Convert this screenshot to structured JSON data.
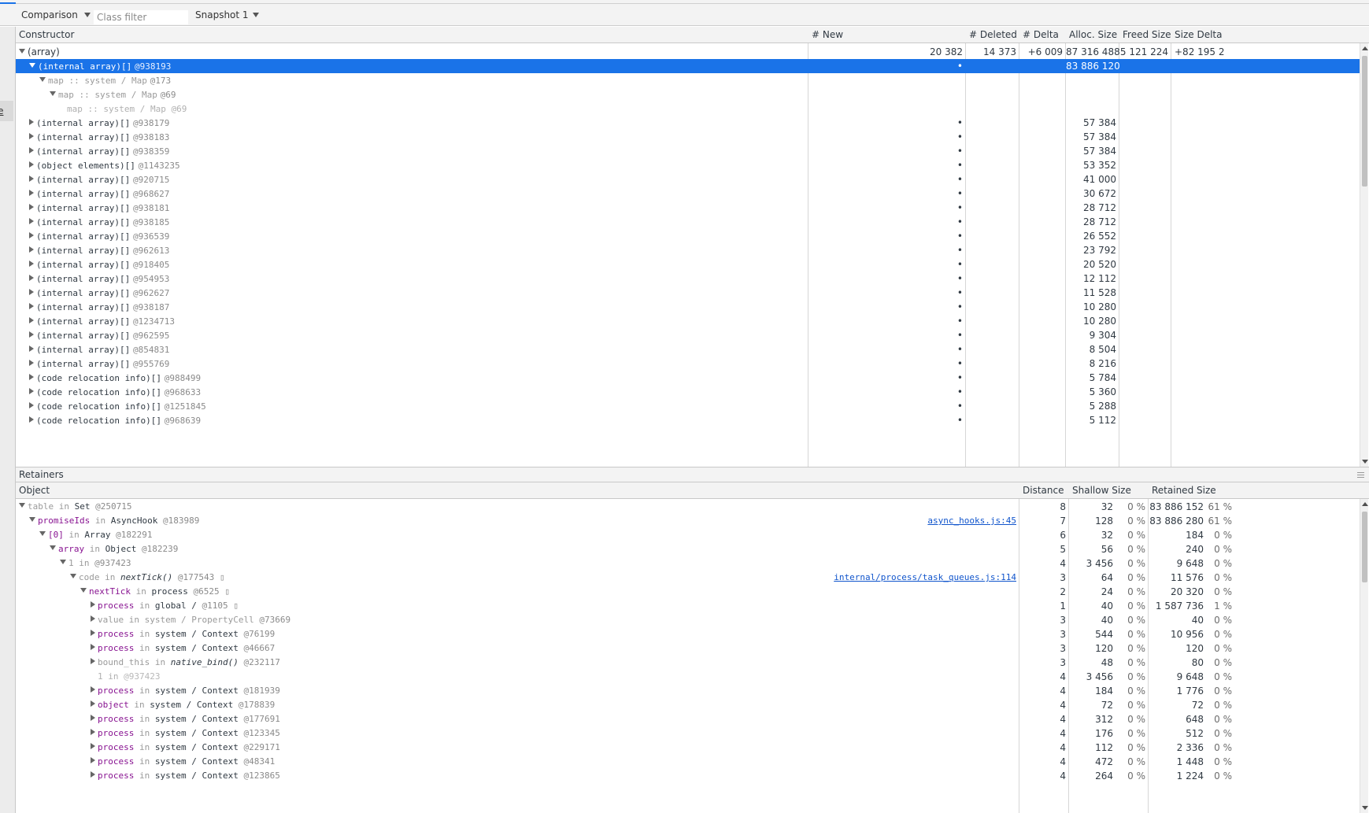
{
  "toolbar": {
    "view_mode": "Comparison",
    "class_filter_placeholder": "Class filter",
    "snapshot": "Snapshot 1"
  },
  "gutter_tab_label": "ve",
  "constructors": {
    "columns": [
      "Constructor",
      "# New",
      "# Deleted",
      "# Delta",
      "Alloc. Size",
      "Freed Size",
      "Size Delta"
    ],
    "rows": [
      {
        "level": 0,
        "state": "expanded",
        "name": "(array)",
        "id": "",
        "plain": true,
        "new": "20 382",
        "deleted": "14 373",
        "delta": "+6 009",
        "alloc": "87 316 488",
        "freed": "5 121 224",
        "sizeDelta": "+82 195 2…"
      },
      {
        "level": 1,
        "state": "expanded",
        "name": "(internal array)[]",
        "id": "@938193",
        "new": "•",
        "deleted": "",
        "delta": "",
        "alloc": "83 886 120",
        "freed": "",
        "sizeDelta": "",
        "selected": true
      },
      {
        "level": 2,
        "state": "expanded",
        "name": "map :: system / Map",
        "id": "@173",
        "greyName": true,
        "new": "",
        "deleted": "",
        "delta": "",
        "alloc": "",
        "freed": "",
        "sizeDelta": ""
      },
      {
        "level": 3,
        "state": "expanded",
        "name": "map :: system / Map",
        "id": "@69",
        "greyName": true,
        "new": "",
        "deleted": "",
        "delta": "",
        "alloc": "",
        "freed": "",
        "sizeDelta": ""
      },
      {
        "level": 4,
        "state": "none",
        "name": "map :: system / Map @69",
        "id": "",
        "faded": true,
        "new": "",
        "deleted": "",
        "delta": "",
        "alloc": "",
        "freed": "",
        "sizeDelta": ""
      },
      {
        "level": 1,
        "state": "collapsed",
        "name": "(internal array)[]",
        "id": "@938179",
        "new": "•",
        "alloc": "57 384"
      },
      {
        "level": 1,
        "state": "collapsed",
        "name": "(internal array)[]",
        "id": "@938183",
        "new": "•",
        "alloc": "57 384"
      },
      {
        "level": 1,
        "state": "collapsed",
        "name": "(internal array)[]",
        "id": "@938359",
        "new": "•",
        "alloc": "57 384"
      },
      {
        "level": 1,
        "state": "collapsed",
        "name": "(object elements)[]",
        "id": "@1143235",
        "new": "•",
        "alloc": "53 352"
      },
      {
        "level": 1,
        "state": "collapsed",
        "name": "(internal array)[]",
        "id": "@920715",
        "new": "•",
        "alloc": "41 000"
      },
      {
        "level": 1,
        "state": "collapsed",
        "name": "(internal array)[]",
        "id": "@968627",
        "new": "•",
        "alloc": "30 672"
      },
      {
        "level": 1,
        "state": "collapsed",
        "name": "(internal array)[]",
        "id": "@938181",
        "new": "•",
        "alloc": "28 712"
      },
      {
        "level": 1,
        "state": "collapsed",
        "name": "(internal array)[]",
        "id": "@938185",
        "new": "•",
        "alloc": "28 712"
      },
      {
        "level": 1,
        "state": "collapsed",
        "name": "(internal array)[]",
        "id": "@936539",
        "new": "•",
        "alloc": "26 552"
      },
      {
        "level": 1,
        "state": "collapsed",
        "name": "(internal array)[]",
        "id": "@962613",
        "new": "•",
        "alloc": "23 792"
      },
      {
        "level": 1,
        "state": "collapsed",
        "name": "(internal array)[]",
        "id": "@918405",
        "new": "•",
        "alloc": "20 520"
      },
      {
        "level": 1,
        "state": "collapsed",
        "name": "(internal array)[]",
        "id": "@954953",
        "new": "•",
        "alloc": "12 112"
      },
      {
        "level": 1,
        "state": "collapsed",
        "name": "(internal array)[]",
        "id": "@962627",
        "new": "•",
        "alloc": "11 528"
      },
      {
        "level": 1,
        "state": "collapsed",
        "name": "(internal array)[]",
        "id": "@938187",
        "new": "•",
        "alloc": "10 280"
      },
      {
        "level": 1,
        "state": "collapsed",
        "name": "(internal array)[]",
        "id": "@1234713",
        "new": "•",
        "alloc": "10 280"
      },
      {
        "level": 1,
        "state": "collapsed",
        "name": "(internal array)[]",
        "id": "@962595",
        "new": "•",
        "alloc": "9 304"
      },
      {
        "level": 1,
        "state": "collapsed",
        "name": "(internal array)[]",
        "id": "@854831",
        "new": "•",
        "alloc": "8 504"
      },
      {
        "level": 1,
        "state": "collapsed",
        "name": "(internal array)[]",
        "id": "@955769",
        "new": "•",
        "alloc": "8 216"
      },
      {
        "level": 1,
        "state": "collapsed",
        "name": "(code relocation info)[]",
        "id": "@988499",
        "new": "•",
        "alloc": "5 784"
      },
      {
        "level": 1,
        "state": "collapsed",
        "name": "(code relocation info)[]",
        "id": "@968633",
        "new": "•",
        "alloc": "5 360"
      },
      {
        "level": 1,
        "state": "collapsed",
        "name": "(code relocation info)[]",
        "id": "@1251845",
        "new": "•",
        "alloc": "5 288"
      },
      {
        "level": 1,
        "state": "collapsed",
        "name": "(code relocation info)[]",
        "id": "@968639",
        "new": "•",
        "alloc": "5 112"
      }
    ]
  },
  "retainers": {
    "title": "Retainers",
    "columns": [
      "Object",
      "Distance",
      "Shallow Size",
      "Retained Size"
    ],
    "rows": [
      {
        "level": 0,
        "state": "expanded",
        "prop": "table",
        "propGrey": true,
        "in": "in",
        "cls": "Set",
        "id": "@250715",
        "link": "",
        "distance": "8",
        "shallow": "32",
        "shallowPct": "0 %",
        "retained": "83 886 152",
        "retainedPct": "61 %"
      },
      {
        "level": 1,
        "state": "expanded",
        "prop": "promiseIds",
        "in": "in",
        "cls": "AsyncHook",
        "id": "@183989",
        "link": "async_hooks.js:45",
        "distance": "7",
        "shallow": "128",
        "shallowPct": "0 %",
        "retained": "83 886 280",
        "retainedPct": "61 %"
      },
      {
        "level": 2,
        "state": "expanded",
        "prop": "[0]",
        "in": "in",
        "cls": "Array",
        "id": "@182291",
        "link": "",
        "distance": "6",
        "shallow": "32",
        "shallowPct": "0 %",
        "retained": "184",
        "retainedPct": "0 %"
      },
      {
        "level": 3,
        "state": "expanded",
        "prop": "array",
        "in": "in",
        "cls": "Object",
        "id": "@182239",
        "link": "",
        "distance": "5",
        "shallow": "56",
        "shallowPct": "0 %",
        "retained": "240",
        "retainedPct": "0 %"
      },
      {
        "level": 4,
        "state": "expanded",
        "prop": "1",
        "propGrey": true,
        "in": "in",
        "cls": "",
        "id": "@937423",
        "link": "",
        "distance": "4",
        "shallow": "3 456",
        "shallowPct": "0 %",
        "retained": "9 648",
        "retainedPct": "0 %"
      },
      {
        "level": 5,
        "state": "expanded",
        "prop": "code",
        "propGrey": true,
        "in": "in",
        "cls": "nextTick()",
        "clsItalic": true,
        "id": "@177543",
        "tag": "▯",
        "link": "internal/process/task_queues.js:114",
        "distance": "3",
        "shallow": "64",
        "shallowPct": "0 %",
        "retained": "11 576",
        "retainedPct": "0 %"
      },
      {
        "level": 6,
        "state": "expanded",
        "prop": "nextTick",
        "in": "in",
        "cls": "process",
        "id": "@6525",
        "tag": "▯",
        "link": "",
        "distance": "2",
        "shallow": "24",
        "shallowPct": "0 %",
        "retained": "20 320",
        "retainedPct": "0 %"
      },
      {
        "level": 7,
        "state": "collapsed",
        "prop": "process",
        "in": "in",
        "cls": "global /",
        "id": "@1105",
        "tag": "▯",
        "link": "",
        "distance": "1",
        "shallow": "40",
        "shallowPct": "0 %",
        "retained": "1 587 736",
        "retainedPct": "1 %"
      },
      {
        "level": 7,
        "state": "collapsed",
        "prop": "value",
        "propGrey": true,
        "in": "in",
        "cls": "system / PropertyCell",
        "clsGrey": true,
        "id": "@73669",
        "link": "",
        "distance": "3",
        "shallow": "40",
        "shallowPct": "0 %",
        "retained": "40",
        "retainedPct": "0 %"
      },
      {
        "level": 7,
        "state": "collapsed",
        "prop": "process",
        "in": "in",
        "cls": "system / Context",
        "id": "@76199",
        "link": "",
        "distance": "3",
        "shallow": "544",
        "shallowPct": "0 %",
        "retained": "10 956",
        "retainedPct": "0 %"
      },
      {
        "level": 7,
        "state": "collapsed",
        "prop": "process",
        "in": "in",
        "cls": "system / Context",
        "id": "@46667",
        "link": "",
        "distance": "3",
        "shallow": "120",
        "shallowPct": "0 %",
        "retained": "120",
        "retainedPct": "0 %"
      },
      {
        "level": 7,
        "state": "collapsed",
        "prop": "bound_this",
        "propGrey": true,
        "in": "in",
        "cls": "native_bind()",
        "clsItalic": true,
        "id": "@232117",
        "link": "",
        "distance": "3",
        "shallow": "48",
        "shallowPct": "0 %",
        "retained": "80",
        "retainedPct": "0 %"
      },
      {
        "level": 7,
        "state": "none",
        "prop": "1",
        "propGrey": true,
        "in": "in",
        "cls": "",
        "id": "@937423",
        "faded": true,
        "link": "",
        "distance": "4",
        "shallow": "3 456",
        "shallowPct": "0 %",
        "retained": "9 648",
        "retainedPct": "0 %"
      },
      {
        "level": 7,
        "state": "collapsed",
        "prop": "process",
        "in": "in",
        "cls": "system / Context",
        "id": "@181939",
        "link": "",
        "distance": "4",
        "shallow": "184",
        "shallowPct": "0 %",
        "retained": "1 776",
        "retainedPct": "0 %"
      },
      {
        "level": 7,
        "state": "collapsed",
        "prop": "object",
        "in": "in",
        "cls": "system / Context",
        "id": "@178839",
        "link": "",
        "distance": "4",
        "shallow": "72",
        "shallowPct": "0 %",
        "retained": "72",
        "retainedPct": "0 %"
      },
      {
        "level": 7,
        "state": "collapsed",
        "prop": "process",
        "in": "in",
        "cls": "system / Context",
        "id": "@177691",
        "link": "",
        "distance": "4",
        "shallow": "312",
        "shallowPct": "0 %",
        "retained": "648",
        "retainedPct": "0 %"
      },
      {
        "level": 7,
        "state": "collapsed",
        "prop": "process",
        "in": "in",
        "cls": "system / Context",
        "id": "@123345",
        "link": "",
        "distance": "4",
        "shallow": "176",
        "shallowPct": "0 %",
        "retained": "512",
        "retainedPct": "0 %"
      },
      {
        "level": 7,
        "state": "collapsed",
        "prop": "process",
        "in": "in",
        "cls": "system / Context",
        "id": "@229171",
        "link": "",
        "distance": "4",
        "shallow": "112",
        "shallowPct": "0 %",
        "retained": "2 336",
        "retainedPct": "0 %"
      },
      {
        "level": 7,
        "state": "collapsed",
        "prop": "process",
        "in": "in",
        "cls": "system / Context",
        "id": "@48341",
        "link": "",
        "distance": "4",
        "shallow": "472",
        "shallowPct": "0 %",
        "retained": "1 448",
        "retainedPct": "0 %"
      },
      {
        "level": 7,
        "state": "collapsed",
        "prop": "process",
        "in": "in",
        "cls": "system / Context",
        "id": "@123865",
        "link": "",
        "distance": "4",
        "shallow": "264",
        "shallowPct": "0 %",
        "retained": "1 224",
        "retainedPct": "0 %"
      }
    ]
  }
}
